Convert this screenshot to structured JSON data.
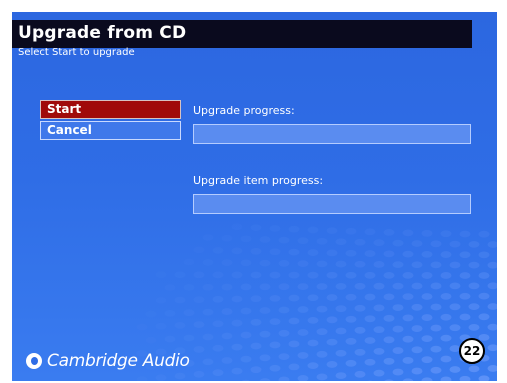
{
  "header": {
    "title": "Upgrade from CD",
    "subtitle": "Select Start to upgrade"
  },
  "menu": {
    "start_label": "Start",
    "cancel_label": "Cancel",
    "selected": "Start"
  },
  "progress": {
    "upgrade_label": "Upgrade progress:",
    "upgrade_value": 0,
    "item_label": "Upgrade item progress:",
    "item_value": 0
  },
  "branding": {
    "logo_text": "Cambridge Audio"
  },
  "page_marker": "22",
  "colors": {
    "background": "#2f6de6",
    "title_bar": "#0a0a1e",
    "selected_button": "#a00a0a",
    "bar_background": "#5a8cf0"
  },
  "icons": {
    "logo": "cambridge-audio-logo-icon"
  }
}
